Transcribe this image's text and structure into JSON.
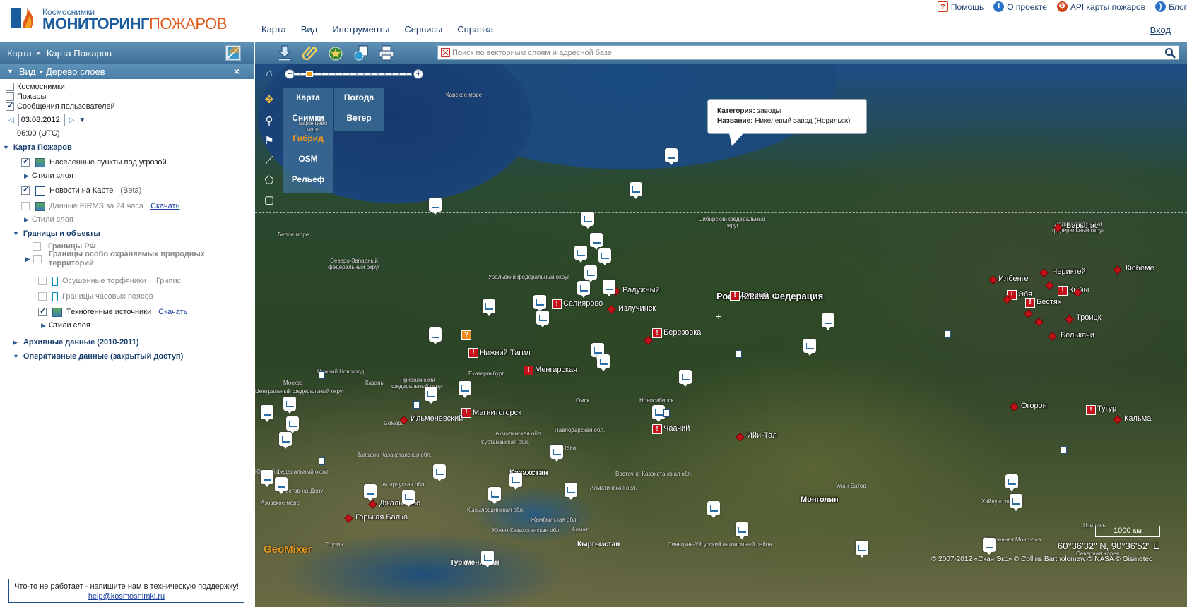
{
  "header": {
    "logo_small": "Космоснимки",
    "logo_big_a": "МОНИТОРИНГ",
    "logo_big_b": "ПОЖАРОВ",
    "top_links": [
      {
        "label": "Помощь",
        "icon": "help-icon",
        "color": "#d03a1a"
      },
      {
        "label": "О проекте",
        "icon": "info-icon",
        "color": "#2a73c8"
      },
      {
        "label": "API карты пожаров",
        "icon": "gear-icon",
        "color": "#d0451a"
      },
      {
        "label": "Блог",
        "icon": "rss-icon",
        "color": "#2a73c8"
      }
    ],
    "menu": [
      "Карта",
      "Вид",
      "Инструменты",
      "Сервисы",
      "Справка"
    ],
    "login": "Вход"
  },
  "left_panel": {
    "breadcrumb": [
      "Карта",
      "Карта Пожаров"
    ],
    "tabs": {
      "view": "Вид",
      "tree": "Дерево слоев"
    },
    "base_layers": [
      {
        "label": "Космоснимки",
        "checked": false
      },
      {
        "label": "Пожары",
        "checked": false
      },
      {
        "label": "Сообщения пользователей",
        "checked": true
      }
    ],
    "date": "03.08.2012",
    "time": "06:00 (UTC)",
    "tree": {
      "root": "Карта Пожаров",
      "items": {
        "populated": "Населенные пункты под угрозой",
        "layer_styles": "Стили слоя",
        "news": "Новости на Карте",
        "news_beta": "(Beta)",
        "firms": "Данные FIRMS за 24 часа",
        "download": "Скачать",
        "layer_styles_2": "Стили слоя",
        "borders_group": "Границы и объекты",
        "borders_rf": "Границы РФ",
        "protected": "Границы особо охраняемых природных территорий",
        "peat": "Осушенные торфяники",
        "gripis": "Грипис",
        "timezones": "Границы часовых поясов",
        "technogenic": "Техногенные источники",
        "download_2": "Скачать",
        "layer_styles_3": "Стили слоя",
        "archive": "Архивные данные (2010-2011)",
        "operative": "Оперативные данные (закрытый доступ)"
      }
    },
    "support": {
      "text": "Что-то не работает - напишите нам в техническую поддержку!",
      "email": "help@kosmosnimki.ru"
    }
  },
  "toolbar": {
    "icons": [
      "download-icon",
      "attach-icon",
      "favorites-icon",
      "share-icon",
      "print-icon"
    ],
    "search_placeholder": "Поиск по векторным слоям и адресной базе"
  },
  "map": {
    "basemap_col1": [
      "Карта",
      "Снимки",
      "Гибрид",
      "OSM",
      "Рельеф"
    ],
    "basemap_col2": [
      "Погода",
      "Ветер"
    ],
    "active_basemap": "Гибрид",
    "popup": {
      "cat_label": "Категория:",
      "cat_value": "заводы",
      "name_label": "Название:",
      "name_value": "Никелевый завод (Норильск)"
    },
    "scale": "1000 км",
    "coords": "60°36'32\" N, 90°36'52\" E",
    "copyright_prefix": "© 2007-2012 «Скан Экс» © Collins Bartholomew © NASA © Gismeteo",
    "geomixer": "GeoMixer",
    "country": "Российская Федерация",
    "country_mongolia": "Монголия",
    "country_kz": "Казахстан",
    "cities": [
      "Барылас",
      "Кюбеме",
      "Чериктей",
      "Илбенге",
      "Кыйы",
      "Эбя",
      "Бестях",
      "Троицк",
      "Белькачи",
      "Радужный",
      "Селиярово",
      "Излучинск",
      "Бурный",
      "Березовка",
      "Нижний Тагил",
      "Менгарская",
      "Магнитогорск",
      "Ильменевский",
      "Чаачий",
      "Ийи-Тал",
      "Огорон",
      "Тугур",
      "Кальма",
      "Джалыково",
      "Горькая Балка"
    ],
    "regions": [
      "Карское море",
      "Баренцево море",
      "Белое море",
      "Северо-Западный федеральный округ",
      "Уральский федеральный округ",
      "Сибирский федеральный округ",
      "Дальневосточный федеральный округ",
      "Приволжский федеральный округ",
      "Москва",
      "Нижний Новгород",
      "Казань",
      "Екатеринбург",
      "Омск",
      "Новосибирск",
      "Павлодарская обл.",
      "Акмолинская обл.",
      "Кустанайская обл.",
      "Астана",
      "Восточно-Казахстанская обл.",
      "Улан-Батор",
      "Хэйлунцзян",
      "Самара",
      "Западно-Казахстанская обл.",
      "Атырауская обл.",
      "Кызылординская обл.",
      "Жамбылская обл.",
      "Алматинская обл.",
      "Южно-Казахстанская обл.",
      "Кыргызстан",
      "Туркменистан",
      "Синьцзян-Уйгурский автономный район",
      "Внутренняя Монголия",
      "Цзилинь",
      "Северная Корея",
      "Грузия",
      "Азовское море",
      "Ростов-на-Дону",
      "Центральный федеральный округ",
      "Южный федеральный округ",
      "Алмат"
    ]
  }
}
